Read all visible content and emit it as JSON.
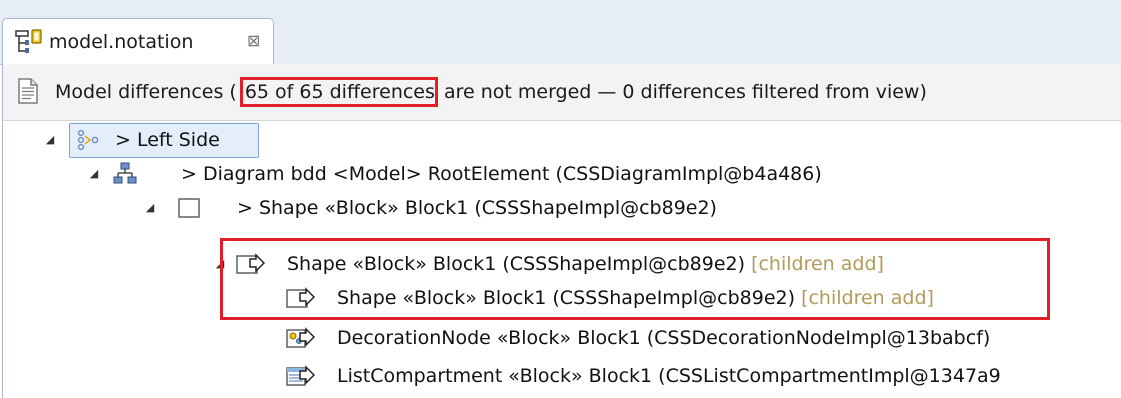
{
  "editor_tab": {
    "title": "model.notation",
    "close_glyph": "⊠",
    "icon": "notation-diagram-icon"
  },
  "info_bar": {
    "icon": "document-icon",
    "prefix": "Model differences (",
    "highlighted": "65 of 65 differences",
    "suffix": " are not merged — 0 differences filtered from view)"
  },
  "tree": {
    "rows": [
      {
        "label": "> Left Side",
        "decoration": "",
        "icon": "comparison-side-icon",
        "expanded": true
      },
      {
        "label": "> Diagram bdd <Model> RootElement (CSSDiagramImpl@b4a486)",
        "decoration": "",
        "icon": "diagram-hierarchy-icon",
        "expanded": true
      },
      {
        "label": "> Shape «Block» Block1 (CSSShapeImpl@cb89e2)",
        "decoration": "",
        "icon": "shape-icon",
        "expanded": true
      },
      {
        "label": "Shape «Block» Block1 (CSSShapeImpl@cb89e2) ",
        "decoration": "[children add]",
        "icon": "shape-add-icon",
        "expanded": true
      },
      {
        "label": "Shape «Block» Block1 (CSSShapeImpl@cb89e2) ",
        "decoration": "[children add]",
        "icon": "shape-add-icon",
        "expanded": false
      },
      {
        "label": "DecorationNode «Block» Block1 (CSSDecorationNodeImpl@13babcf)",
        "decoration": "",
        "icon": "decoration-node-add-icon",
        "expanded": false
      },
      {
        "label": "ListCompartment «Block» Block1 (CSSListCompartmentImpl@1347a9",
        "decoration": "",
        "icon": "list-compartment-add-icon",
        "expanded": false
      }
    ]
  },
  "colors": {
    "highlight_red": "#e11f26",
    "decoration_text": "#b39a5a",
    "tab_bar_bg": "#e7edf6",
    "info_bar_bg": "#f3f3f3",
    "add_arrow": "#3a3a3a"
  }
}
